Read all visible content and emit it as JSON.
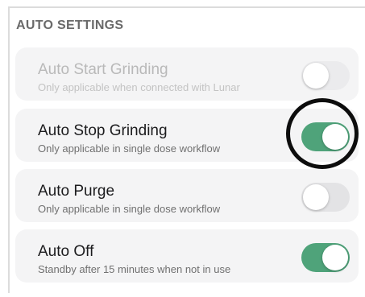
{
  "section": {
    "title": "AUTO SETTINGS"
  },
  "settings": [
    {
      "title": "Auto Start Grinding",
      "subtitle": "Only applicable when connected with Lunar",
      "enabled": false,
      "disabled": true
    },
    {
      "title": "Auto Stop Grinding",
      "subtitle": "Only applicable in single dose workflow",
      "enabled": true,
      "disabled": false,
      "highlighted": true
    },
    {
      "title": "Auto Purge",
      "subtitle": "Only applicable in single dose workflow",
      "enabled": false,
      "disabled": false
    },
    {
      "title": "Auto Off",
      "subtitle": "Standby after 15 minutes when not in use",
      "enabled": true,
      "disabled": false
    }
  ],
  "colors": {
    "toggle_on": "#4fa37a",
    "toggle_off": "#e3e3e5",
    "highlight_ring": "#0d0d0d"
  }
}
